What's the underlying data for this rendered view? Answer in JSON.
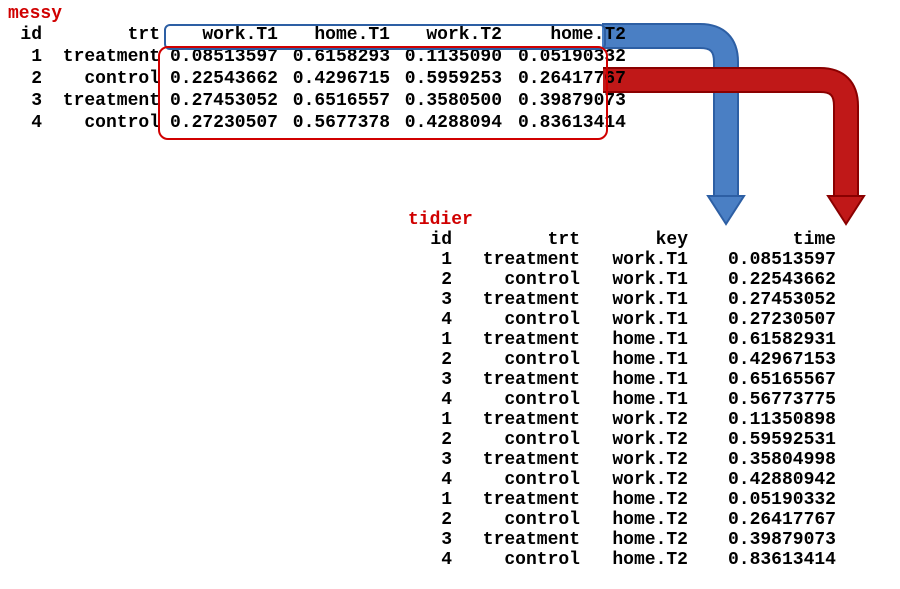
{
  "messy": {
    "title": "messy",
    "headers": [
      "id",
      "trt",
      "work.T1",
      "home.T1",
      "work.T2",
      "home.T2"
    ],
    "rows": [
      {
        "id": "1",
        "trt": "treatment",
        "v": [
          "0.08513597",
          "0.6158293",
          "0.1135090",
          "0.05190332"
        ]
      },
      {
        "id": "2",
        "trt": "control",
        "v": [
          "0.22543662",
          "0.4296715",
          "0.5959253",
          "0.26417767"
        ]
      },
      {
        "id": "3",
        "trt": "treatment",
        "v": [
          "0.27453052",
          "0.6516557",
          "0.3580500",
          "0.39879073"
        ]
      },
      {
        "id": "4",
        "trt": "control",
        "v": [
          "0.27230507",
          "0.5677378",
          "0.4288094",
          "0.83613414"
        ]
      }
    ]
  },
  "tidier": {
    "title": "tidier",
    "headers": [
      "id",
      "trt",
      "key",
      "time"
    ],
    "rows": [
      {
        "id": "1",
        "trt": "treatment",
        "key": "work.T1",
        "time": "0.08513597"
      },
      {
        "id": "2",
        "trt": "control",
        "key": "work.T1",
        "time": "0.22543662"
      },
      {
        "id": "3",
        "trt": "treatment",
        "key": "work.T1",
        "time": "0.27453052"
      },
      {
        "id": "4",
        "trt": "control",
        "key": "work.T1",
        "time": "0.27230507"
      },
      {
        "id": "1",
        "trt": "treatment",
        "key": "home.T1",
        "time": "0.61582931"
      },
      {
        "id": "2",
        "trt": "control",
        "key": "home.T1",
        "time": "0.42967153"
      },
      {
        "id": "3",
        "trt": "treatment",
        "key": "home.T1",
        "time": "0.65165567"
      },
      {
        "id": "4",
        "trt": "control",
        "key": "home.T1",
        "time": "0.56773775"
      },
      {
        "id": "1",
        "trt": "treatment",
        "key": "work.T2",
        "time": "0.11350898"
      },
      {
        "id": "2",
        "trt": "control",
        "key": "work.T2",
        "time": "0.59592531"
      },
      {
        "id": "3",
        "trt": "treatment",
        "key": "work.T2",
        "time": "0.35804998"
      },
      {
        "id": "4",
        "trt": "control",
        "key": "work.T2",
        "time": "0.42880942"
      },
      {
        "id": "1",
        "trt": "treatment",
        "key": "home.T2",
        "time": "0.05190332"
      },
      {
        "id": "2",
        "trt": "control",
        "key": "home.T2",
        "time": "0.26417767"
      },
      {
        "id": "3",
        "trt": "treatment",
        "key": "home.T2",
        "time": "0.39879073"
      },
      {
        "id": "4",
        "trt": "control",
        "key": "home.T2",
        "time": "0.83613414"
      }
    ]
  },
  "arrows": {
    "blue_label_semantic": "column-names-to-key",
    "red_label_semantic": "cell-values-to-time"
  }
}
